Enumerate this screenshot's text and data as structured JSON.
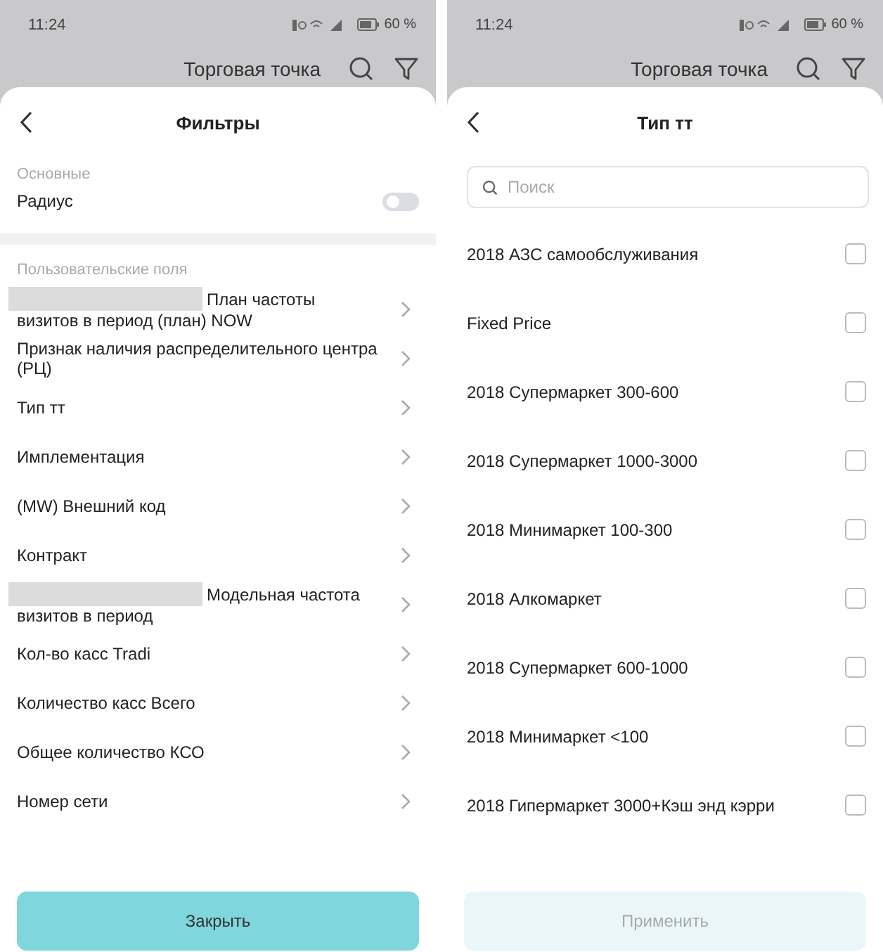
{
  "filters_screen": {
    "status_bar": {
      "time": "11:24",
      "battery": "60 %"
    },
    "app_bar": {
      "title": "Торговая точка"
    },
    "sheet": {
      "title": "Фильтры",
      "main_section": {
        "heading": "Основные",
        "toggle": {
          "label": "Радиус",
          "on": false
        }
      },
      "custom_section": {
        "heading": "Пользовательские поля",
        "items": [
          {
            "lines": [
              "План частоты",
              "визитов в период (план) NOW"
            ],
            "redacted": true
          },
          {
            "label": "Признак наличия распределительного центра (РЦ)",
            "redacted": false
          },
          {
            "label": "Тип тт",
            "redacted": false
          },
          {
            "label": "Имплементация",
            "redacted": false
          },
          {
            "label": "(MW) Внешний код",
            "redacted": false
          },
          {
            "label": "Контракт",
            "redacted": false
          },
          {
            "lines": [
              "Модельная частота",
              "визитов в период"
            ],
            "redacted": true
          },
          {
            "label": "Кол-во касс Tradi",
            "redacted": false
          },
          {
            "label": "Количество касс Всего",
            "redacted": false
          },
          {
            "label": "Общее количество КСО",
            "redacted": false
          },
          {
            "label": "Номер сети",
            "redacted": false
          }
        ]
      },
      "button": {
        "label": "Закрыть",
        "disabled": false
      }
    }
  },
  "type_screen": {
    "status_bar": {
      "time": "11:24",
      "battery": "60 %"
    },
    "app_bar": {
      "title": "Торговая точка"
    },
    "sheet": {
      "title": "Тип тт",
      "search": {
        "placeholder": "Поиск"
      },
      "options": [
        {
          "label": "2018 АЗС самообслуживания",
          "checked": false
        },
        {
          "label": "Fixed Price",
          "checked": false
        },
        {
          "label": "2018 Супермаркет 300-600",
          "checked": false
        },
        {
          "label": "2018 Супермаркет 1000-3000",
          "checked": false
        },
        {
          "label": "2018 Минимаркет 100-300",
          "checked": false
        },
        {
          "label": "2018 Алкомаркет",
          "checked": false
        },
        {
          "label": "2018 Супермаркет 600-1000",
          "checked": false
        },
        {
          "label": "2018 Минимаркет <100",
          "checked": false
        },
        {
          "label": "2018 Гипермаркет 3000+Кэш энд кэрри",
          "checked": false
        }
      ],
      "button": {
        "label": "Применить",
        "disabled": true
      }
    }
  }
}
